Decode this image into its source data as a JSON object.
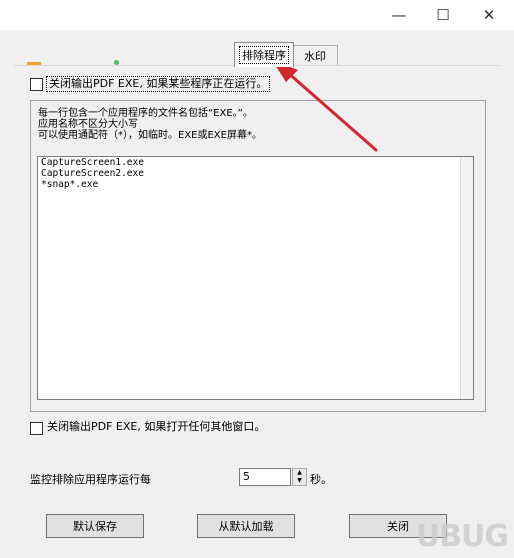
{
  "window": {
    "minimize_glyph": "—",
    "maximize_glyph": "☐",
    "close_glyph": "✕"
  },
  "tabs": [
    {
      "label": "排除程序",
      "active": true
    },
    {
      "label": "水印",
      "active": false
    }
  ],
  "top_checkbox": {
    "label": "关闭输出PDF EXE, 如果某些程序正在运行。",
    "checked": false
  },
  "description": {
    "line1": "每一行包含一个应用程序的文件名包括“EXE。”。",
    "line2": "应用名称不区分大小写",
    "line3": "可以使用通配符（*），如临时。EXE或EXE屏幕*。"
  },
  "exclude_list": [
    "CaptureScreen1.exe",
    "CaptureScreen2.exe",
    "*snap*.exe"
  ],
  "bottom_checkbox": {
    "label": "关闭输出PDF EXE, 如果打开任何其他窗口。",
    "checked": false
  },
  "monitor": {
    "label": "监控排除应用程序运行每",
    "value": "5",
    "unit": "秒。"
  },
  "buttons": {
    "save_default": "默认保存",
    "load_default": "从默认加载",
    "close": "关闭"
  },
  "watermark": {
    "text": "UBUG"
  },
  "colors": {
    "annotation_arrow": "#d0282c",
    "tab_accent_orange": "#f0a030",
    "tab_accent_green": "#5cb85c"
  }
}
